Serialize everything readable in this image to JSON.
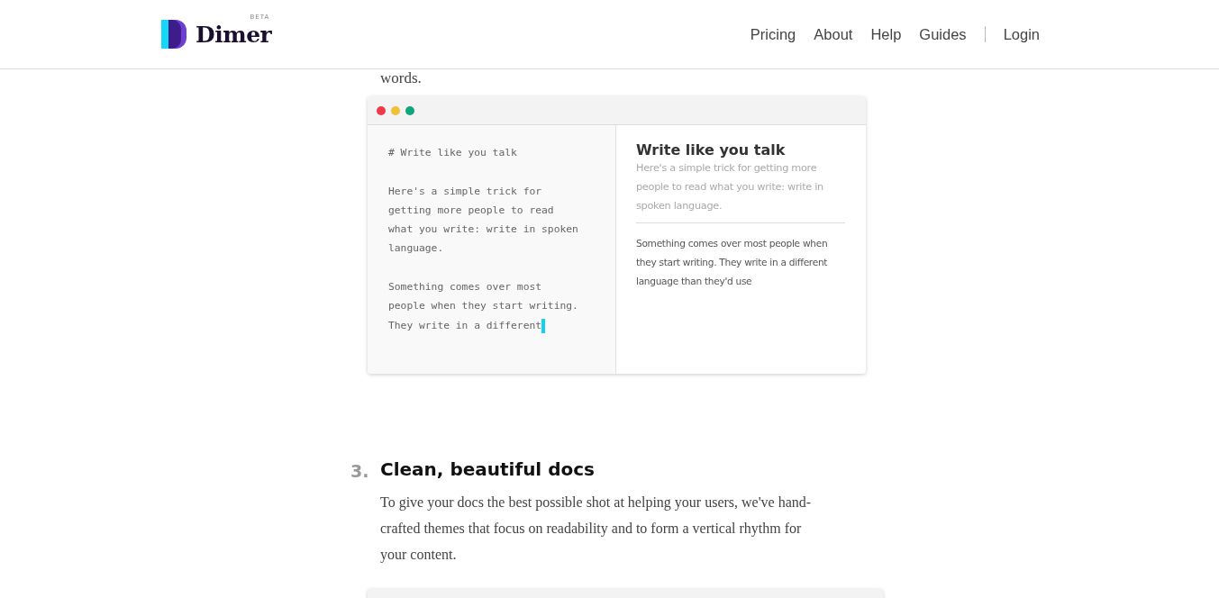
{
  "header": {
    "logo": {
      "name": "Dimer",
      "badge": "BETA"
    },
    "nav": [
      "Pricing",
      "About",
      "Help",
      "Guides"
    ],
    "login": "Login"
  },
  "intro_tail": "words.",
  "mock_window": {
    "editor": {
      "paragraphs": [
        {
          "lines": [
            "# Write like you talk"
          ]
        },
        {
          "lines": [
            "Here's a simple trick for",
            "getting more people to read",
            "what you write: write in spoken",
            "language."
          ]
        },
        {
          "lines": [
            "Something comes over most",
            "people when they start writing.",
            "They write in a different"
          ]
        }
      ]
    },
    "preview": {
      "title": "Write like you talk",
      "lead": "Here's a simple trick for getting more people to read what you write: write in spoken language.",
      "body": "Something comes over most people when they start writing. They write in a different language than they'd use"
    }
  },
  "section": {
    "number": "3.",
    "title": "Clean, beautiful docs",
    "text": "To give your docs the best possible shot at helping your users, we've hand-crafted themes that focus on readability and to form a vertical rhythm for your content."
  }
}
